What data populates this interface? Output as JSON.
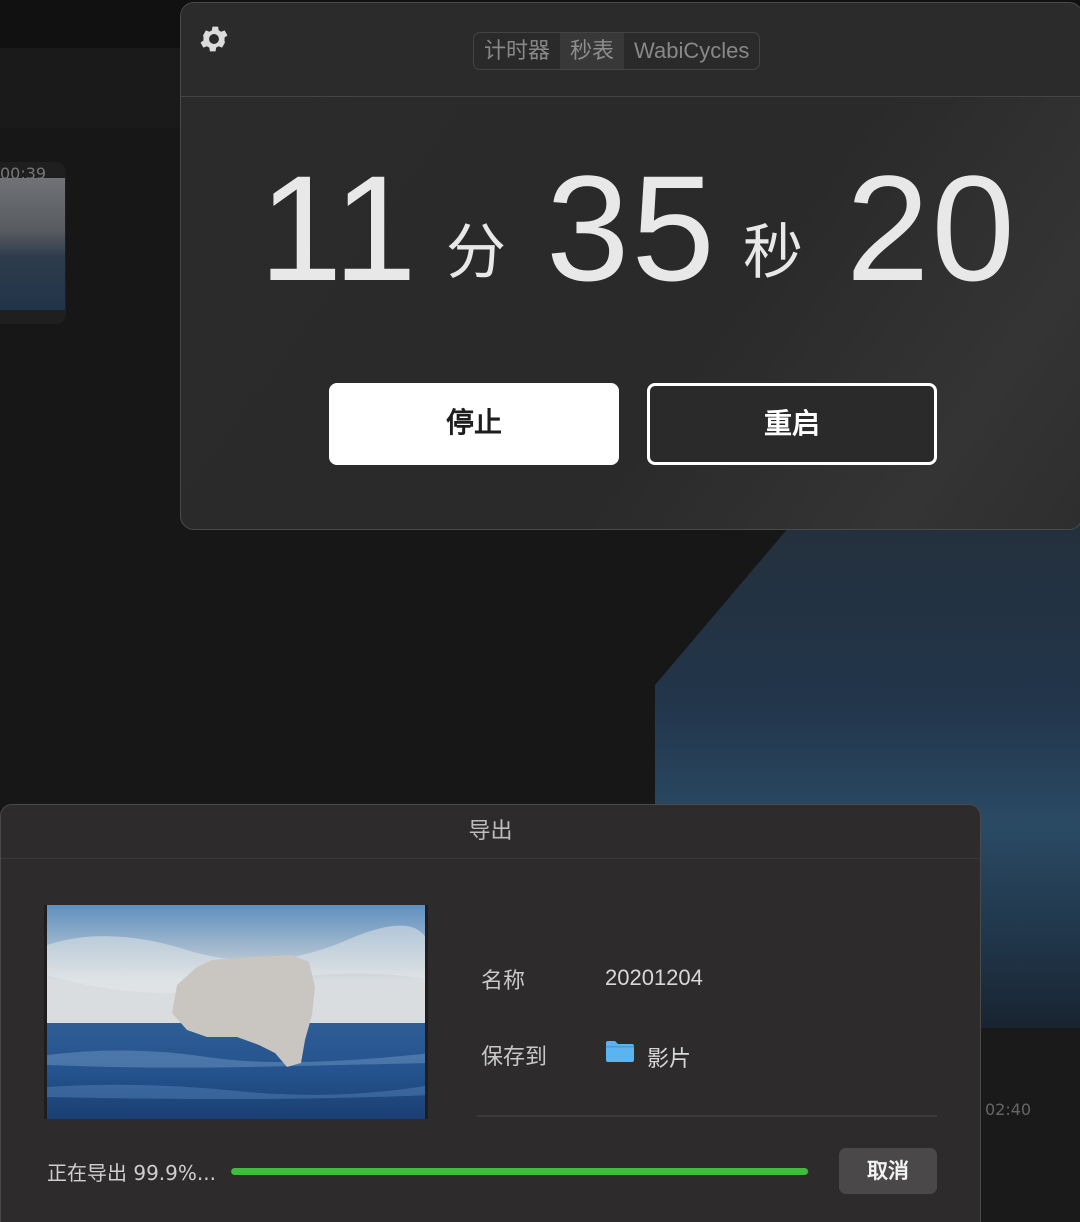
{
  "background": {
    "clip_timestamp": "00:39",
    "timeline_timestamp": "02:40"
  },
  "stopwatch": {
    "tabs": [
      "计时器",
      "秒表",
      "WabiCycles"
    ],
    "active_tab": "秒表",
    "minutes": "11",
    "minutes_unit": "分",
    "seconds": "35",
    "seconds_unit": "秒",
    "centiseconds": "20",
    "stop_label": "停止",
    "restart_label": "重启",
    "icon": "gear-icon"
  },
  "export": {
    "title": "导出",
    "name_label": "名称",
    "name_value": "20201204",
    "save_to_label": "保存到",
    "save_to_value": "影片",
    "folder_icon": "folder-icon",
    "folder_color": "#5ab4f0",
    "status": "正在导出 99.9%...",
    "progress_percent": 99.9,
    "progress_color": "#3cc03a",
    "cancel_label": "取消"
  }
}
